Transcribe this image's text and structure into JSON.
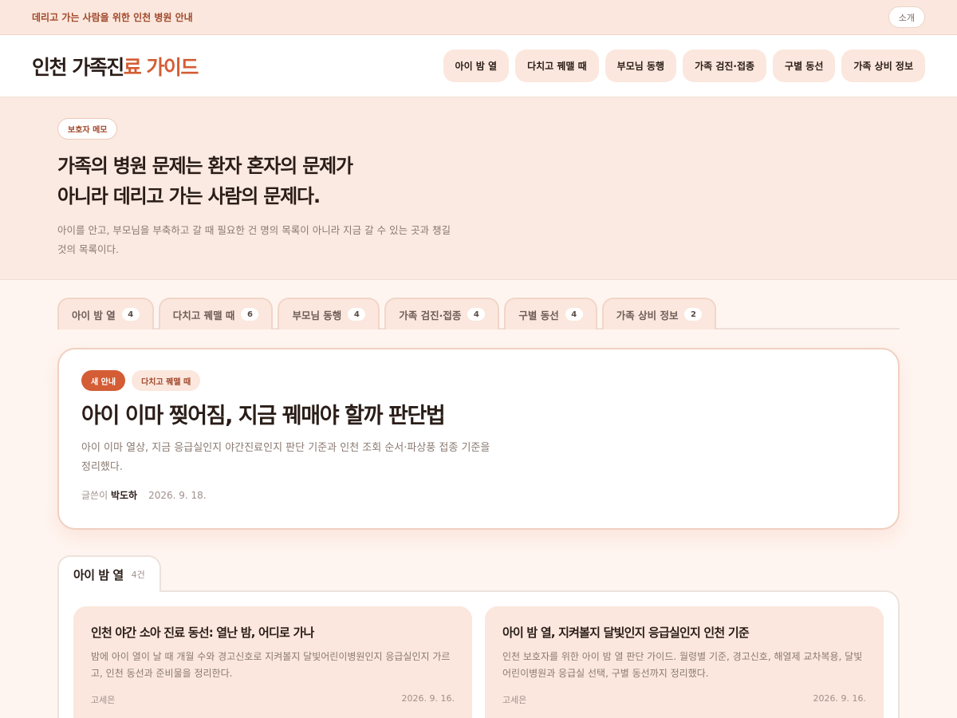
{
  "topbar": {
    "tagline": "데리고 가는 사람을 위한 인천 병원 안내",
    "about_label": "소개"
  },
  "header": {
    "logo_main": "인천 가족진",
    "logo_accent": "료 가이드",
    "nav": [
      "아이 밤 열",
      "다치고 꿰맬 때",
      "부모님 동행",
      "가족 검진·접종",
      "구별 동선",
      "가족 상비 정보"
    ]
  },
  "hero": {
    "chip": "보호자 메모",
    "title_line1": "가족의 병원 문제는 환자 혼자의 문제가",
    "title_line2": "아니라 데리고 가는 사람의 문제다.",
    "desc": "아이를 안고, 부모님을 부축하고 갈 때 필요한 건 명의 목록이 아니라 지금 갈 수 있는 곳과 챙길 것의 목록이다."
  },
  "tabs": [
    {
      "label": "아이 밤 열",
      "count": "4"
    },
    {
      "label": "다치고 꿰맬 때",
      "count": "6"
    },
    {
      "label": "부모님 동행",
      "count": "4"
    },
    {
      "label": "가족 검진·접종",
      "count": "4"
    },
    {
      "label": "구별 동선",
      "count": "4"
    },
    {
      "label": "가족 상비 정보",
      "count": "2"
    }
  ],
  "feature": {
    "badge_new": "새 안내",
    "badge_category": "다치고 꿰맬 때",
    "title": "아이 이마 찢어짐, 지금 꿰매야 할까 판단법",
    "desc": "아이 이마 열상, 지금 응급실인지 야간진료인지 판단 기준과 인천 조회 순서·파상풍 접종 기준을 정리했다.",
    "author_label": "글쓴이",
    "author": "박도하",
    "date": "2026. 9. 18."
  },
  "section": {
    "title": "아이 밤 열",
    "count": "4건",
    "cards": [
      {
        "title": "인천 야간 소아 진료 동선: 열난 밤, 어디로 가나",
        "desc": "밤에 아이 열이 날 때 개월 수와 경고신호로 지켜볼지 달빛어린이병원인지 응급실인지 가르고, 인천 동선과 준비물을 정리한다.",
        "author": "고세은",
        "date": "2026. 9. 16."
      },
      {
        "title": "아이 밤 열, 지켜볼지 달빛인지 응급실인지 인천 기준",
        "desc": "인천 보호자를 위한 아이 밤 열 판단 가이드. 월령별 기준, 경고신호, 해열제 교차복용, 달빛어린이병원과 응급실 선택, 구별 동선까지 정리했다.",
        "author": "고세은",
        "date": "2026. 9. 16."
      }
    ]
  }
}
